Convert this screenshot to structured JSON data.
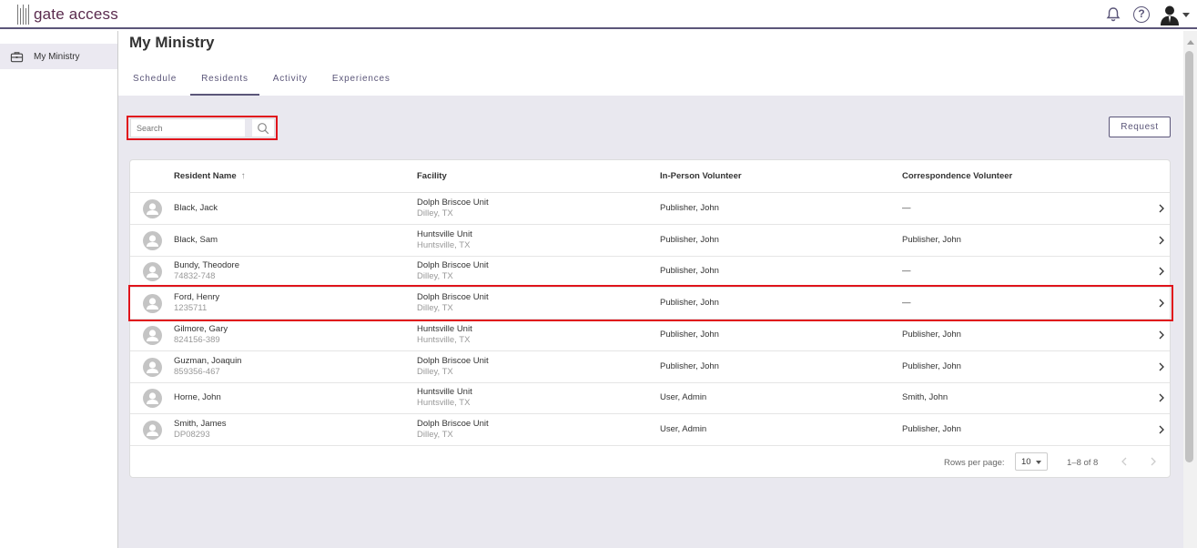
{
  "app": {
    "logo_text": "gate access"
  },
  "topbar": {
    "help_glyph": "?"
  },
  "sidebar": {
    "items": [
      {
        "label": "My Ministry",
        "icon": "briefcase-icon"
      }
    ]
  },
  "main": {
    "title": "My Ministry",
    "tabs": [
      {
        "label": "Schedule",
        "active": false
      },
      {
        "label": "Residents",
        "active": true
      },
      {
        "label": "Activity",
        "active": false
      },
      {
        "label": "Experiences",
        "active": false
      }
    ],
    "search": {
      "placeholder": "Search"
    },
    "request_label": "Request"
  },
  "table": {
    "columns": [
      "Resident Name",
      "Facility",
      "In-Person Volunteer",
      "Correspondence Volunteer"
    ],
    "sort_indicator": "↑",
    "rows": [
      {
        "name": "Black, Jack",
        "id": "",
        "facility": "Dolph Briscoe Unit",
        "location": "Dilley, TX",
        "in_person": "Publisher, John",
        "correspondence": "—"
      },
      {
        "name": "Black, Sam",
        "id": "",
        "facility": "Huntsville Unit",
        "location": "Huntsville, TX",
        "in_person": "Publisher, John",
        "correspondence": "Publisher, John"
      },
      {
        "name": "Bundy, Theodore",
        "id": "74832-748",
        "facility": "Dolph Briscoe Unit",
        "location": "Dilley, TX",
        "in_person": "Publisher, John",
        "correspondence": "—"
      },
      {
        "name": "Ford, Henry",
        "id": "1235711",
        "facility": "Dolph Briscoe Unit",
        "location": "Dilley, TX",
        "in_person": "Publisher, John",
        "correspondence": "—"
      },
      {
        "name": "Gilmore, Gary",
        "id": "824156-389",
        "facility": "Huntsville Unit",
        "location": "Huntsville, TX",
        "in_person": "Publisher, John",
        "correspondence": "Publisher, John"
      },
      {
        "name": "Guzman, Joaquin",
        "id": "859356-467",
        "facility": "Dolph Briscoe Unit",
        "location": "Dilley, TX",
        "in_person": "Publisher, John",
        "correspondence": "Publisher, John"
      },
      {
        "name": "Horne, John",
        "id": "",
        "facility": "Huntsville Unit",
        "location": "Huntsville, TX",
        "in_person": "User, Admin",
        "correspondence": "Smith, John"
      },
      {
        "name": "Smith, James",
        "id": "DP08293",
        "facility": "Dolph Briscoe Unit",
        "location": "Dilley, TX",
        "in_person": "User, Admin",
        "correspondence": "Publisher, John"
      }
    ],
    "pagination": {
      "rows_per_page_label": "Rows per page:",
      "rows_per_page": "10",
      "range": "1–8 of 8"
    }
  },
  "colors": {
    "accent": "#5b5679",
    "highlight": "#e0141b",
    "logo": "#5a2b4e"
  }
}
